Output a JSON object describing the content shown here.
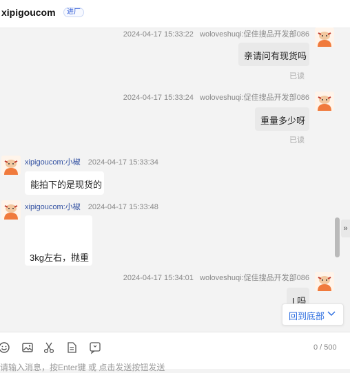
{
  "header": {
    "title": "xipigoucom",
    "badge": "进厂"
  },
  "messages": [
    {
      "direction": "out",
      "time": "2024-04-17 15:33:22",
      "sender": "woloveshuqi:促佳搜品开发部086",
      "text": "亲请问有现货吗",
      "status": "已读"
    },
    {
      "direction": "out",
      "time": "2024-04-17 15:33:24",
      "sender": "woloveshuqi:促佳搜品开发部086",
      "text": "重量多少呀",
      "status": "已读"
    },
    {
      "direction": "in",
      "time": "2024-04-17 15:33:34",
      "sender": "xipigoucom:小椒",
      "text": "能拍下的是现货的"
    },
    {
      "direction": "in",
      "time": "2024-04-17 15:33:48",
      "sender": "xipigoucom:小椒",
      "text": "3kg左右，抛重"
    },
    {
      "direction": "out",
      "time": "2024-04-17 15:34:01",
      "sender": "woloveshuqi:促佳搜品开发部086",
      "text": "L吗"
    }
  ],
  "back_to_bottom": "回到底部",
  "toolbar": {
    "icons": [
      "emoji-icon",
      "image-icon",
      "scissors-icon",
      "document-icon",
      "quick-reply-icon"
    ],
    "counter": "0 / 500",
    "placeholder": "请输入消息，按Enter键 或 点击发送按钮发送"
  },
  "colors": {
    "link_blue": "#2f6fe0",
    "sender_blue": "#2f4ea0",
    "out_bubble": "#e9e9e9",
    "in_bubble": "#ffffff"
  }
}
